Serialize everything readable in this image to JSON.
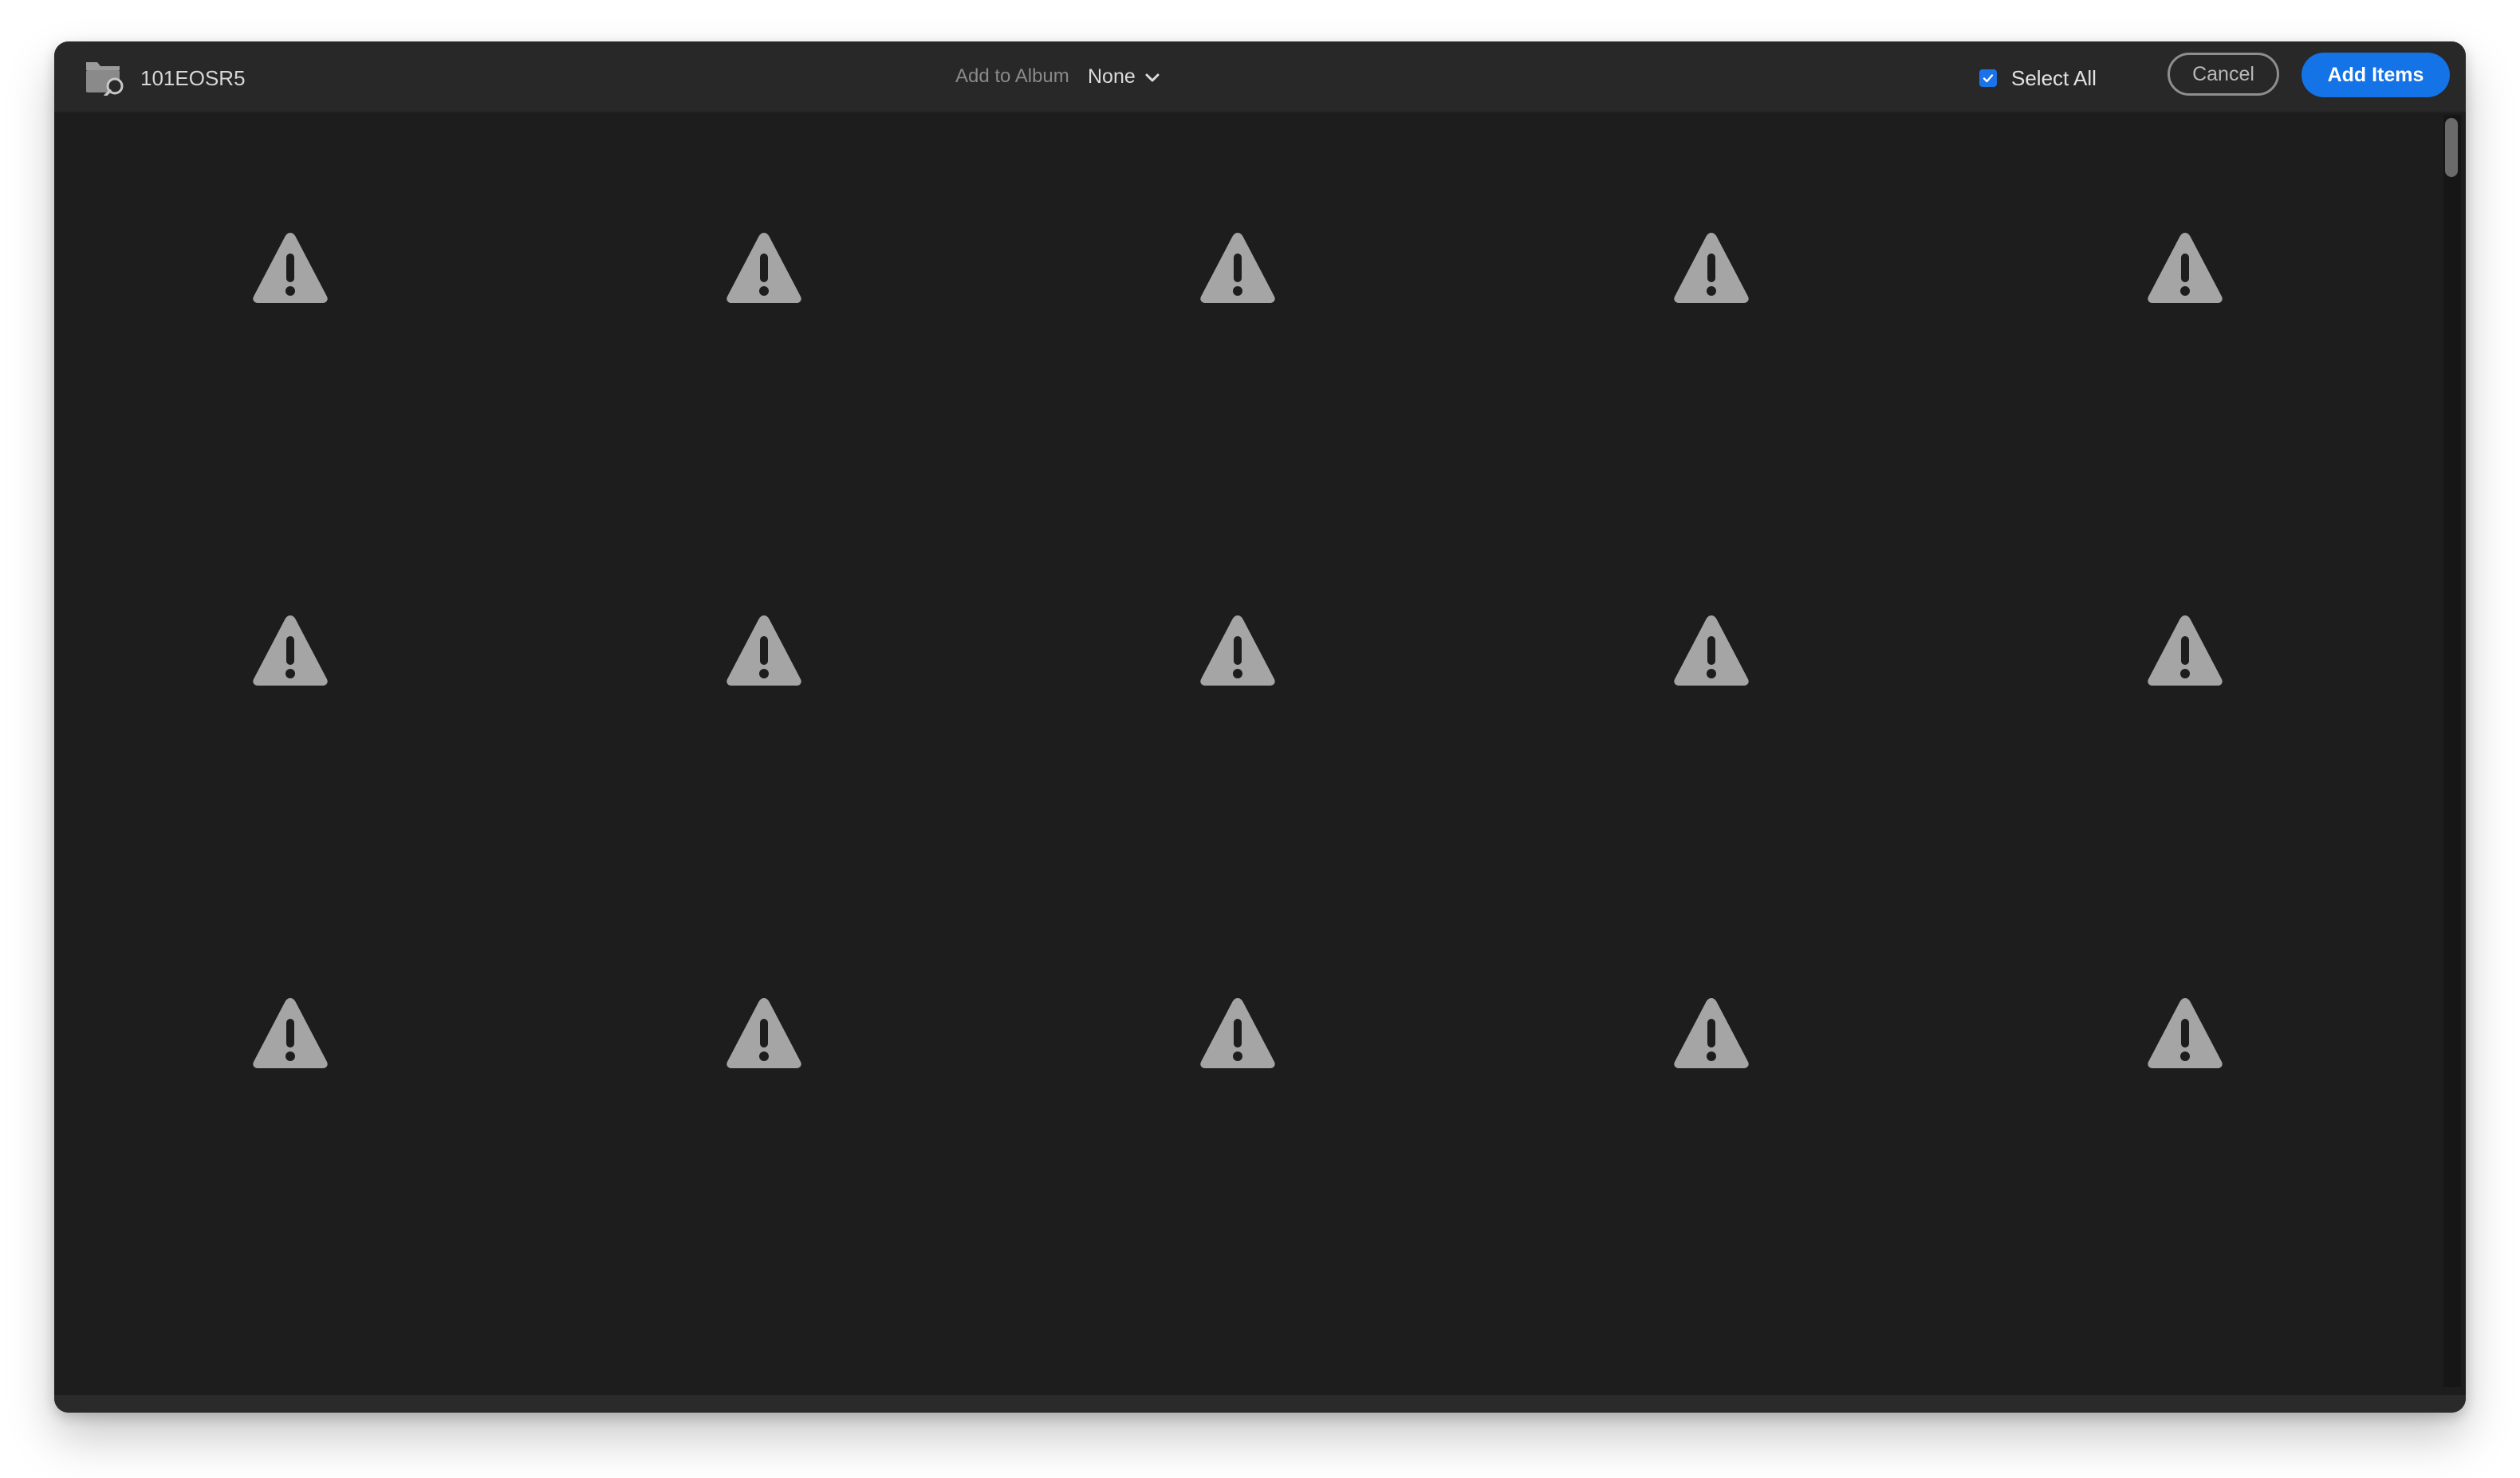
{
  "header": {
    "folder_name": "101EOSR5",
    "folder_icon": "folder-search-icon",
    "album_label": "Add to Album",
    "album_value": "None",
    "select_all_label": "Select All",
    "select_all_checked": true,
    "cancel_label": "Cancel",
    "add_label": "Add Items"
  },
  "grid": {
    "columns": 5,
    "rows": 3,
    "item_icon": "warning-icon",
    "item_count": 15
  },
  "colors": {
    "accent": "#1473e6",
    "background": "#1d1d1d",
    "titlebar": "#282828",
    "warning_icon": "#a5a5a5"
  }
}
